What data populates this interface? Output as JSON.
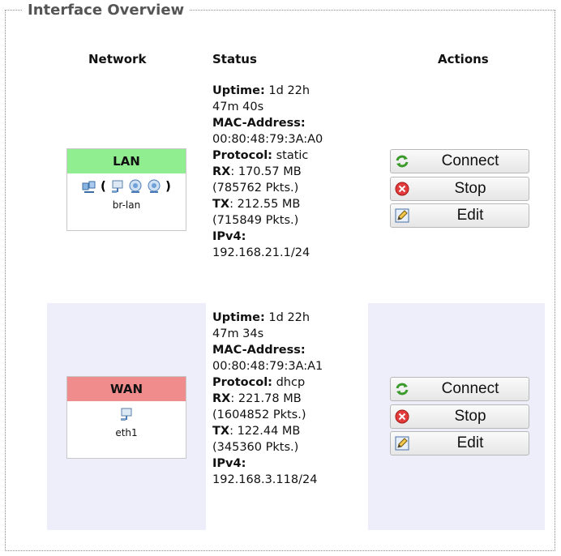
{
  "section_title": "Interface Overview",
  "columns": {
    "network": "Network",
    "status": "Status",
    "actions": "Actions"
  },
  "interfaces": [
    {
      "name": "LAN",
      "color": "#90ee90",
      "device": "br-lan",
      "status": {
        "uptime_label": "Uptime:",
        "uptime_line1": "1d 22h",
        "uptime_line2": "47m 40s",
        "mac_label": "MAC-Address:",
        "mac": "00:80:48:79:3A:A0",
        "protocol_label": "Protocol:",
        "protocol": "static",
        "rx_label": "RX",
        "rx": ": 170.57 MB",
        "rx_pkts": "(785762 Pkts.)",
        "tx_label": "TX",
        "tx": ": 212.55 MB",
        "tx_pkts": "(715849 Pkts.)",
        "ipv4_label": "IPv4:",
        "ipv4": "192.168.21.1/24"
      }
    },
    {
      "name": "WAN",
      "color": "#f08c8c",
      "device": "eth1",
      "status": {
        "uptime_label": "Uptime:",
        "uptime_line1": "1d 22h",
        "uptime_line2": "47m 34s",
        "mac_label": "MAC-Address:",
        "mac": "00:80:48:79:3A:A1",
        "protocol_label": "Protocol:",
        "protocol": "dhcp",
        "rx_label": "RX",
        "rx": ": 221.78 MB",
        "rx_pkts": "(1604852 Pkts.)",
        "tx_label": "TX",
        "tx": ": 122.44 MB",
        "tx_pkts": "(345360 Pkts.)",
        "ipv4_label": "IPv4:",
        "ipv4": "192.168.3.118/24"
      }
    }
  ],
  "buttons": {
    "connect": "Connect",
    "stop": "Stop",
    "edit": "Edit"
  }
}
